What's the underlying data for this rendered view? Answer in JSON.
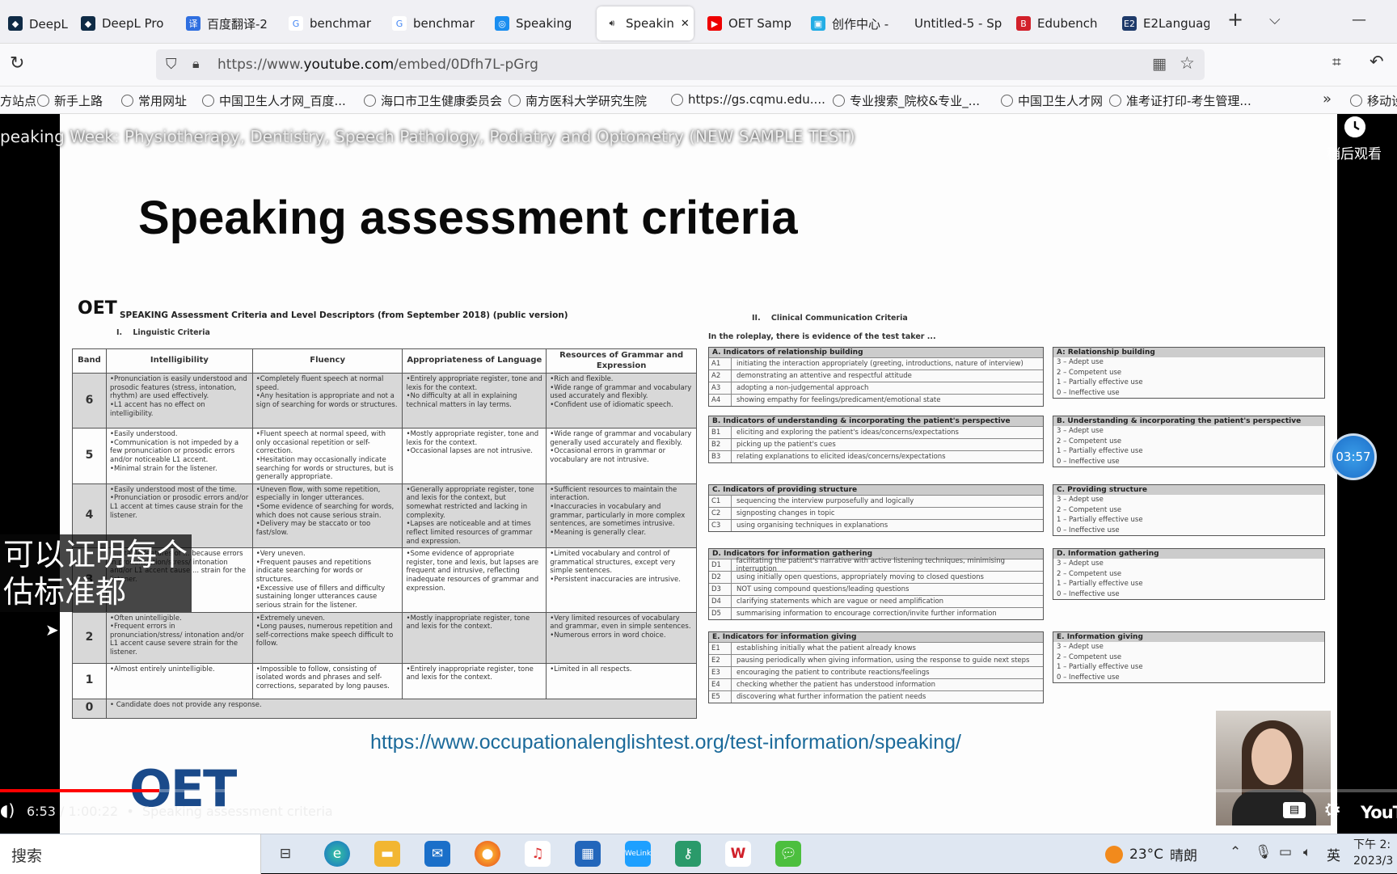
{
  "browser": {
    "tabs": [
      {
        "label": "DeepL翻译",
        "icon": "deepl-icon"
      },
      {
        "label": "DeepL Pro",
        "icon": "deepl-icon"
      },
      {
        "label": "百度翻译-2",
        "icon": "baidu-translate-icon"
      },
      {
        "label": "benchmar",
        "icon": "google-icon"
      },
      {
        "label": "benchmar",
        "icon": "google-icon"
      },
      {
        "label": "Speaking",
        "icon": "scan-icon"
      },
      {
        "label": "Speakin",
        "icon": "speaker-icon",
        "active": true
      },
      {
        "label": "OET Samp",
        "icon": "youtube-icon"
      },
      {
        "label": "创作中心 -",
        "icon": "bilibili-icon"
      },
      {
        "label": "Untitled-5 - Sp",
        "icon": "none"
      },
      {
        "label": "Edubench",
        "icon": "b-icon"
      },
      {
        "label": "E2Languag",
        "icon": "e2-icon"
      }
    ],
    "url_prefix": "https://www.",
    "url_domain": "youtube.com",
    "url_path": "/embed/0Dfh7L-pGrg",
    "bookmarks": [
      "方站点",
      "新手上路",
      "常用网址",
      "中国卫生人才网_百度...",
      "海口市卫生健康委员会",
      "南方医科大学研究生院",
      "https://gs.cqmu.edu....",
      "专业搜索_院校&专业_...",
      "中国卫生人才网",
      "准考证打印-考生管理...",
      "移动设"
    ]
  },
  "video": {
    "title": "peaking Week: Physiotherapy, Dentistry, Speech Pathology, Podiatry and Optometry (NEW SAMPLE TEST)",
    "watch_later": "稍后观看",
    "timer_badge": "03:57",
    "subtitle_line1": "可以证明每个",
    "subtitle_line2": "估标准都",
    "time": "6:53 / 1:00:22",
    "chapter": "Speaking assessment criteria",
    "progress": 0.114,
    "yt_logo": "YouTu"
  },
  "slide": {
    "heading": "Speaking assessment criteria",
    "oet_small": "OET",
    "doc_title": "SPEAKING Assessment Criteria and Level Descriptors (from September 2018) (public version)",
    "section1": "I.    Linguistic Criteria",
    "section2": "II.    Clinical Communication Criteria",
    "roleplay_note": "In the roleplay, there is evidence of the test taker ...",
    "ling_headers": [
      "Band",
      "Intelligibility",
      "Fluency",
      "Appropriateness of Language",
      "Resources of Grammar and Expression"
    ],
    "ling_rows": [
      {
        "band": "6",
        "cells": [
          "•Pronunciation is easily understood and prosodic features (stress, intonation, rhythm) are used effectively.\n•L1 accent has no effect on intelligibility.",
          "•Completely fluent speech at normal speed.\n•Any hesitation is appropriate and not a sign of searching for words or structures.",
          "•Entirely appropriate register, tone and lexis for the context.\n•No difficulty at all in explaining technical matters in lay terms.",
          "•Rich and flexible.\n•Wide range of grammar and vocabulary used accurately and flexibly.\n•Confident use of idiomatic speech."
        ]
      },
      {
        "band": "5",
        "cells": [
          "•Easily understood.\n•Communication is not impeded by a few pronunciation or prosodic errors and/or noticeable L1 accent.\n•Minimal strain for the listener.",
          "•Fluent speech at normal speed, with only occasional repetition or self-correction.\n•Hesitation may occasionally indicate searching for words or structures, but is generally appropriate.",
          "•Mostly appropriate register, tone and lexis for the context.\n•Occasional lapses are not intrusive.",
          "•Wide range of grammar and vocabulary generally used accurately and flexibly.\n•Occasional errors in grammar or vocabulary are not intrusive."
        ]
      },
      {
        "band": "4",
        "cells": [
          "•Easily understood most of the time.\n•Pronunciation or prosodic errors and/or L1 accent at times cause strain for the listener.",
          "•Uneven flow, with some repetition, especially in longer utterances.\n•Some evidence of searching for words, which does not cause serious strain.\n•Delivery may be staccato or too fast/slow.",
          "•Generally appropriate register, tone and lexis for the context, but somewhat restricted and lacking in complexity.\n•Lapses are noticeable and at times reflect limited resources of grammar and expression.",
          "•Sufficient resources to maintain the interaction.\n•Inaccuracies in vocabulary and grammar, particularly in more complex sentences, are sometimes intrusive.\n•Meaning is generally clear."
        ]
      },
      {
        "band": "3",
        "cells": [
          "•...stable features of ... because errors in pronunciation/stress/ intonation and/or L1 accent cause ... strain for the listener.",
          "•Very uneven.\n•Frequent pauses and repetitions indicate searching for words or structures.\n•Excessive use of fillers and difficulty sustaining longer utterances cause serious strain for the listener.",
          "•Some evidence of appropriate register, tone and lexis, but lapses are frequent and intrusive, reflecting inadequate resources of grammar and expression.",
          "•Limited vocabulary and control of grammatical structures, except very simple sentences.\n•Persistent inaccuracies are intrusive."
        ]
      },
      {
        "band": "2",
        "cells": [
          "•Often unintelligible.\n•Frequent errors in pronunciation/stress/ intonation and/or L1 accent cause severe strain for the listener.",
          "•Extremely uneven.\n•Long pauses, numerous repetition and self-corrections make speech difficult to follow.",
          "•Mostly inappropriate register, tone and lexis for the context.",
          "•Very limited resources of vocabulary and grammar, even in simple sentences.\n•Numerous errors in word choice."
        ]
      },
      {
        "band": "1",
        "cells": [
          "•Almost entirely unintelligible.",
          "•Impossible to follow, consisting of isolated words and phrases and self-corrections, separated by long pauses.",
          "•Entirely inappropriate register, tone and lexis for the context.",
          "•Limited in all respects."
        ]
      }
    ],
    "band0_text": "•   Candidate does not provide any response.",
    "clinical": [
      {
        "head": "A. Indicators of relationship building",
        "items": [
          [
            "A1",
            "initiating the interaction appropriately (greeting, introductions, nature of interview)"
          ],
          [
            "A2",
            "demonstrating an attentive and respectful attitude"
          ],
          [
            "A3",
            "adopting a non-judgemental approach"
          ],
          [
            "A4",
            "showing empathy for feelings/predicament/emotional state"
          ]
        ],
        "scale_head": "A: Relationship building"
      },
      {
        "head": "B. Indicators of understanding & incorporating the patient's perspective",
        "items": [
          [
            "B1",
            "eliciting and exploring the patient's ideas/concerns/expectations"
          ],
          [
            "B2",
            "picking up the patient's cues"
          ],
          [
            "B3",
            "relating explanations to elicited ideas/concerns/expectations"
          ]
        ],
        "scale_head": "B. Understanding & incorporating the patient's perspective"
      },
      {
        "head": "C. Indicators of providing structure",
        "items": [
          [
            "C1",
            "sequencing the interview purposefully and logically"
          ],
          [
            "C2",
            "signposting changes in topic"
          ],
          [
            "C3",
            "using organising techniques in explanations"
          ]
        ],
        "scale_head": "C. Providing structure"
      },
      {
        "head": "D. Indicators for information gathering",
        "items": [
          [
            "D1",
            "facilitating the patient's narrative with active listening techniques, minimising interruption"
          ],
          [
            "D2",
            "using initially open questions, appropriately moving to closed questions"
          ],
          [
            "D3",
            "NOT using compound questions/leading questions"
          ],
          [
            "D4",
            "clarifying statements which are vague or need amplification"
          ],
          [
            "D5",
            "summarising information to encourage correction/invite further information"
          ]
        ],
        "scale_head": "D. Information gathering"
      },
      {
        "head": "E. Indicators for information giving",
        "items": [
          [
            "E1",
            "establishing initially what the patient already knows"
          ],
          [
            "E2",
            "pausing periodically when giving information, using the response to guide next steps"
          ],
          [
            "E3",
            "encouraging the patient to contribute reactions/feelings"
          ],
          [
            "E4",
            "checking whether the patient has understood information"
          ],
          [
            "E5",
            "discovering what further information the patient needs"
          ]
        ],
        "scale_head": "E.  Information giving"
      }
    ],
    "scale": [
      "3 – Adept use",
      "2 – Competent use",
      "1 – Partially effective use",
      "0 – Ineffective use"
    ],
    "link": "https://www.occupationalenglishtest.org/test-information/speaking/",
    "big_logo": "OET"
  },
  "taskbar": {
    "search": "搜索",
    "weather_temp": "23°C",
    "weather_text": "晴朗",
    "ime": "英",
    "clock_line1": "下午 2:",
    "clock_line2": "2023/3"
  }
}
